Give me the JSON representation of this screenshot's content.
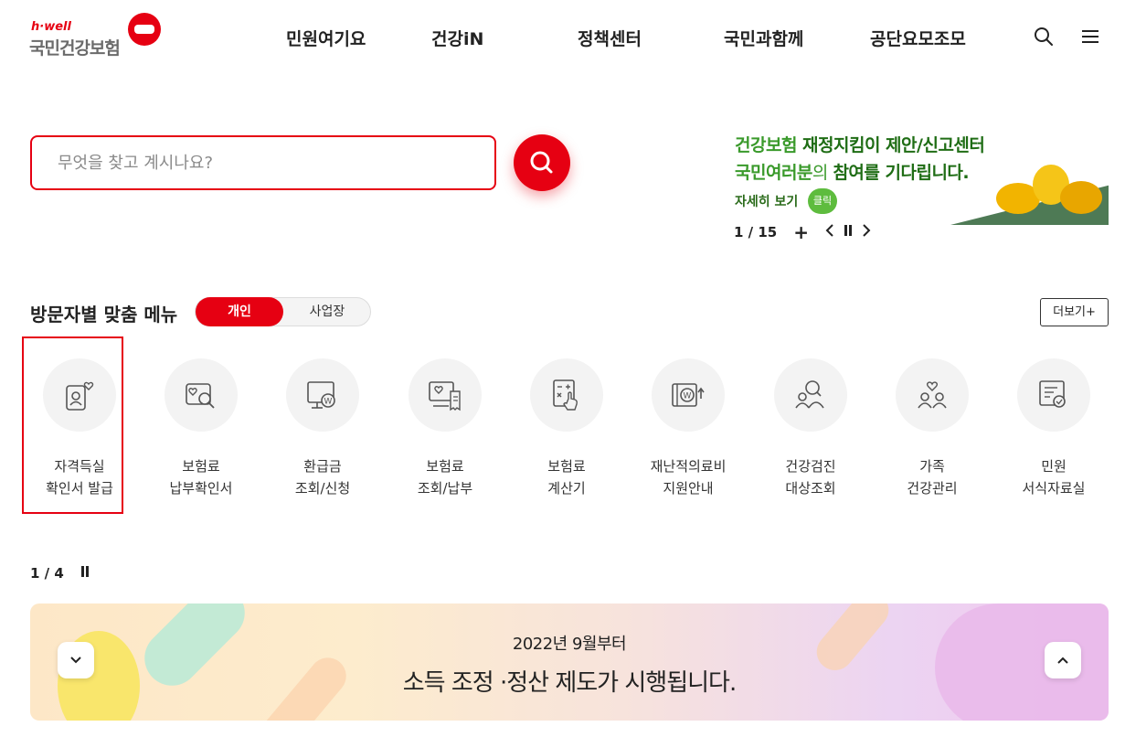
{
  "header": {
    "logo": {
      "tagline": "h·well",
      "name": "국민건강보험"
    },
    "nav": [
      "민원여기요",
      "건강iN",
      "정책센터",
      "국민과함께",
      "공단요모조모"
    ],
    "icons": {
      "search": "search-icon",
      "menu": "hamburger-menu-icon"
    }
  },
  "search": {
    "placeholder": "무엇을 찾고 계시나요?",
    "value": ""
  },
  "banner": {
    "line1_a": "건강보험 ",
    "line1_b": "재정지킴이 제안/신고센터",
    "line2_a": "국민여러분",
    "line2_b": "의 ",
    "line2_c": "참여",
    "line2_d": "를 기다립니다.",
    "detail": "자세히 보기",
    "click": "클릭",
    "pager": {
      "current": "1",
      "total": "15",
      "text": "1 / 15"
    }
  },
  "menu_section": {
    "title": "방문자별 맞춤 메뉴",
    "toggle": {
      "active": "개인",
      "inactive": "사업장"
    },
    "more": "더보기+",
    "items": [
      {
        "line1": "자격득실",
        "line2": "확인서 발급",
        "icon": "id-card-heart-icon"
      },
      {
        "line1": "보험료",
        "line2": "납부확인서",
        "icon": "search-heart-document-icon"
      },
      {
        "line1": "환급금",
        "line2": "조회/신청",
        "icon": "monitor-won-icon"
      },
      {
        "line1": "보험료",
        "line2": "조회/납부",
        "icon": "screen-receipt-icon"
      },
      {
        "line1": "보험료",
        "line2": "계산기",
        "icon": "calculator-hand-icon"
      },
      {
        "line1": "재난적의료비",
        "line2": "지원안내",
        "icon": "wallet-won-arrow-icon"
      },
      {
        "line1": "건강검진",
        "line2": "대상조회",
        "icon": "people-search-icon"
      },
      {
        "line1": "가족",
        "line2": "건강관리",
        "icon": "family-heart-icon"
      },
      {
        "line1": "민원",
        "line2": "서식자료실",
        "icon": "form-document-check-icon"
      }
    ],
    "pager": {
      "text": "1 / 4"
    }
  },
  "bottom_banner": {
    "line1": "2022년 9월부터",
    "line2": "소득 조정 ·정산 제도가 시행됩니다."
  },
  "colors": {
    "brand": "#e60012",
    "banner_green": "#3a9a2b"
  }
}
